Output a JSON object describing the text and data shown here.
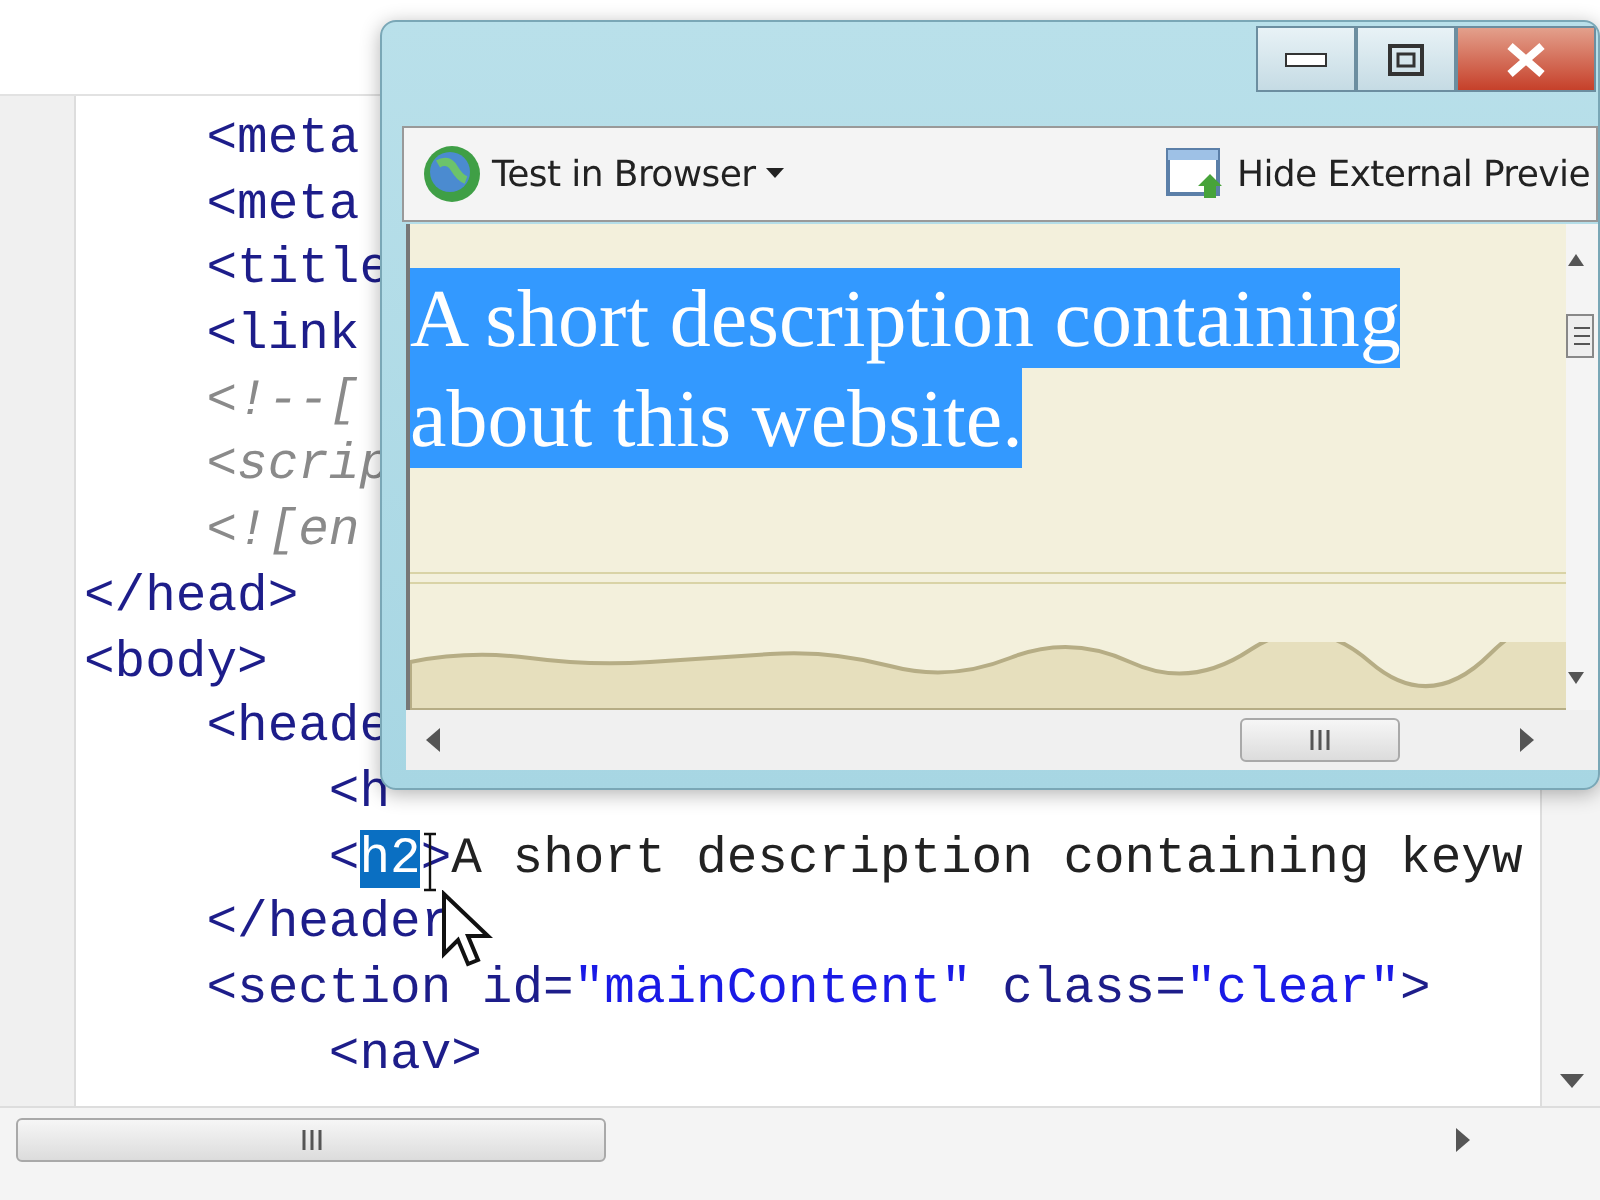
{
  "editor": {
    "lines": [
      {
        "tokens": [
          {
            "kind": "tag",
            "text": "    <meta"
          }
        ]
      },
      {
        "tokens": [
          {
            "kind": "tag",
            "text": "    <meta"
          }
        ]
      },
      {
        "tokens": [
          {
            "kind": "tag",
            "text": "    <title"
          }
        ]
      },
      {
        "tokens": [
          {
            "kind": "tag",
            "text": "    <link"
          }
        ]
      },
      {
        "tokens": [
          {
            "kind": "comment",
            "text": "    <!--["
          }
        ]
      },
      {
        "tokens": [
          {
            "kind": "comment",
            "text": "    <scrip"
          }
        ]
      },
      {
        "tokens": [
          {
            "kind": "comment",
            "text": "    <![en"
          }
        ]
      },
      {
        "tokens": [
          {
            "kind": "tag",
            "text": "</head>"
          }
        ]
      },
      {
        "tokens": [
          {
            "kind": "tag",
            "text": "<body>"
          }
        ]
      },
      {
        "tokens": [
          {
            "kind": "tag",
            "text": "    <heade"
          }
        ]
      },
      {
        "tokens": [
          {
            "kind": "tag",
            "text": "        <h"
          }
        ]
      },
      {
        "tokens": [
          {
            "kind": "tag",
            "text": "        <"
          },
          {
            "kind": "selected",
            "text": "h2"
          },
          {
            "kind": "tag",
            "text": ">"
          },
          {
            "kind": "text",
            "text": "A short description containing keyw"
          }
        ]
      },
      {
        "tokens": [
          {
            "kind": "tag",
            "text": "    </header"
          }
        ]
      },
      {
        "tokens": [
          {
            "kind": "tag",
            "text": "    <section id="
          },
          {
            "kind": "string",
            "text": "\"mainContent\""
          },
          {
            "kind": "tag",
            "text": " class="
          },
          {
            "kind": "string",
            "text": "\"clear\""
          },
          {
            "kind": "tag",
            "text": ">"
          }
        ]
      },
      {
        "tokens": [
          {
            "kind": "tag",
            "text": "        <nav>"
          }
        ]
      }
    ]
  },
  "preview_window": {
    "toolbar": {
      "test_button": "Test in Browser",
      "hide_button": "Hide External Previe"
    },
    "heading_lines": [
      "A short description containing",
      "about this website."
    ],
    "heading_selected": true
  }
}
